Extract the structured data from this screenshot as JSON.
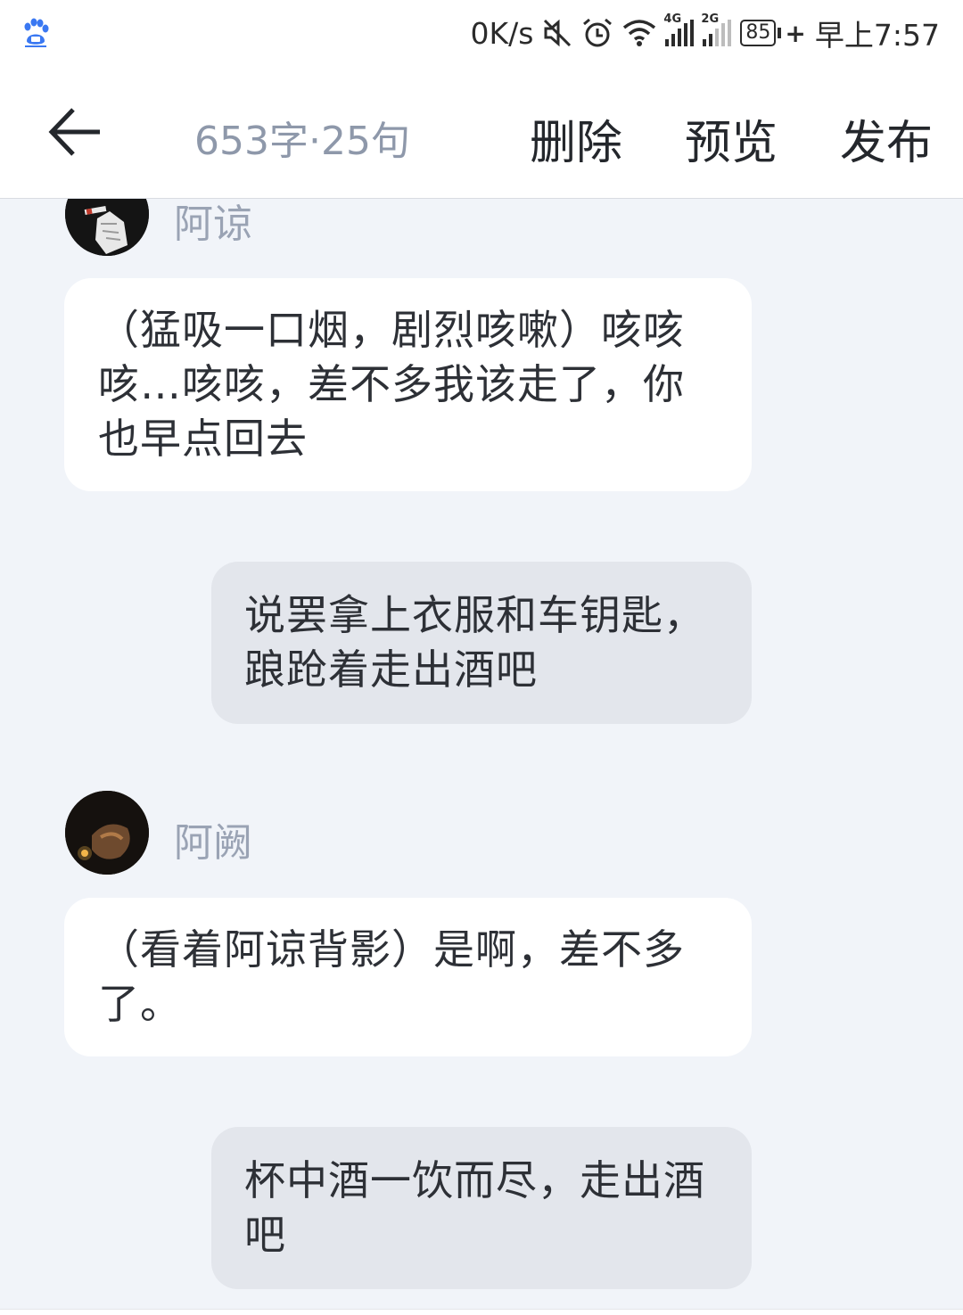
{
  "status_bar": {
    "speed": "0K/s",
    "net1": "4G",
    "net2": "2G",
    "battery": "85",
    "time": "早上7:57",
    "icons": [
      "baidu-paw-icon",
      "mute-icon",
      "alarm-icon",
      "wifi-icon",
      "signal-4g-icon",
      "signal-2g-icon",
      "battery-icon",
      "charging-icon"
    ]
  },
  "header": {
    "back_icon": "arrow-left-icon",
    "count": "653字·25句",
    "delete_label": "删除",
    "preview_label": "预览",
    "publish_label": "发布"
  },
  "messages": [
    {
      "type": "speaker",
      "name": "阿谅"
    },
    {
      "type": "left",
      "text": "（猛吸一口烟，剧烈咳嗽）咳咳咳…咳咳，差不多我该走了，你也早点回去"
    },
    {
      "type": "right",
      "text": "说罢拿上衣服和车钥匙，踉跄着走出酒吧"
    },
    {
      "type": "speaker",
      "name": "阿阙"
    },
    {
      "type": "left",
      "text": "（看着阿谅背影）是啊，差不多了。"
    },
    {
      "type": "right",
      "text": "杯中酒一饮而尽，走出酒吧"
    }
  ],
  "colors": {
    "background": "#f1f4f9",
    "bubble_left": "#ffffff",
    "bubble_right": "#e3e6ec",
    "name": "#9aa3b4",
    "count": "#8e98aa"
  }
}
